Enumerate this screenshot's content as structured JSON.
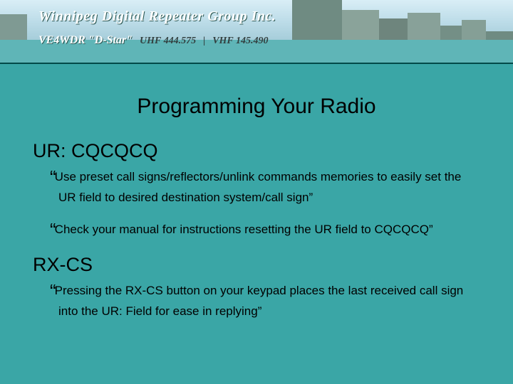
{
  "banner": {
    "org_name": "Winnipeg Digital Repeater Group Inc.",
    "callsign_line": "VE4WDR \"D-Star\"",
    "freq_uhf": "UHF 444.575",
    "freq_vhf": "VHF 145.490"
  },
  "title": "Programming Your Radio",
  "sections": [
    {
      "heading": "UR: CQCQCQ",
      "bullets": [
        "Use preset call signs/reflectors/unlink commands memories to easily set the UR field to desired destination system/call sign”",
        "Check your manual for instructions resetting the UR field to CQCQCQ”"
      ]
    },
    {
      "heading": "RX-CS",
      "bullets": [
        "Pressing the RX-CS button on your keypad places the last received call sign into the UR: Field for ease in replying”"
      ]
    }
  ]
}
